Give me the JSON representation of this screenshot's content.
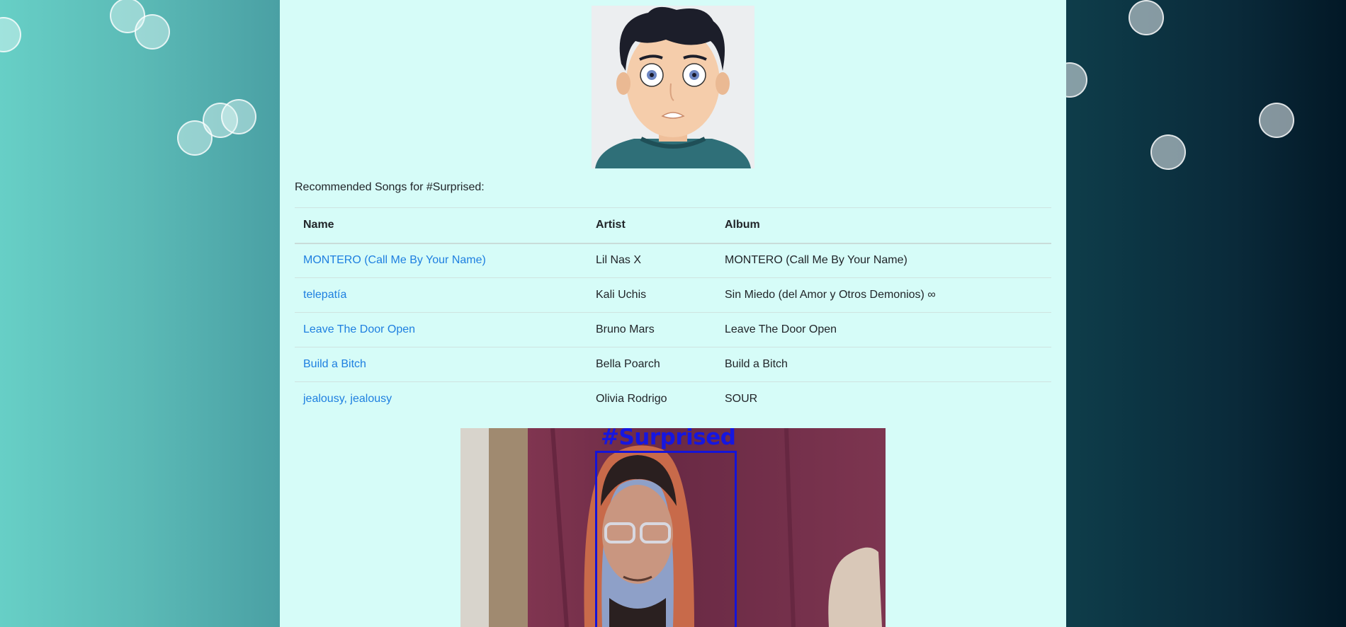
{
  "heading": "Recommended Songs for #Surprised:",
  "table": {
    "headers": [
      "Name",
      "Artist",
      "Album"
    ],
    "rows": [
      {
        "name": "MONTERO (Call Me By Your Name)",
        "artist": "Lil Nas X",
        "album": "MONTERO (Call Me By Your Name)"
      },
      {
        "name": "telepatía",
        "artist": "Kali Uchis",
        "album": "Sin Miedo (del Amor y Otros Demonios) ∞"
      },
      {
        "name": "Leave The Door Open",
        "artist": "Bruno Mars",
        "album": "Leave The Door Open"
      },
      {
        "name": "Build a Bitch",
        "artist": "Bella Poarch",
        "album": "Build a Bitch"
      },
      {
        "name": "jealousy, jealousy",
        "artist": "Olivia Rodrigo",
        "album": "SOUR"
      }
    ]
  },
  "webcam": {
    "emotion_label": "#Surprised"
  },
  "colors": {
    "page_bg": "#d6fcf8",
    "link": "#1e7fe0",
    "detect_box": "#1414d8"
  }
}
